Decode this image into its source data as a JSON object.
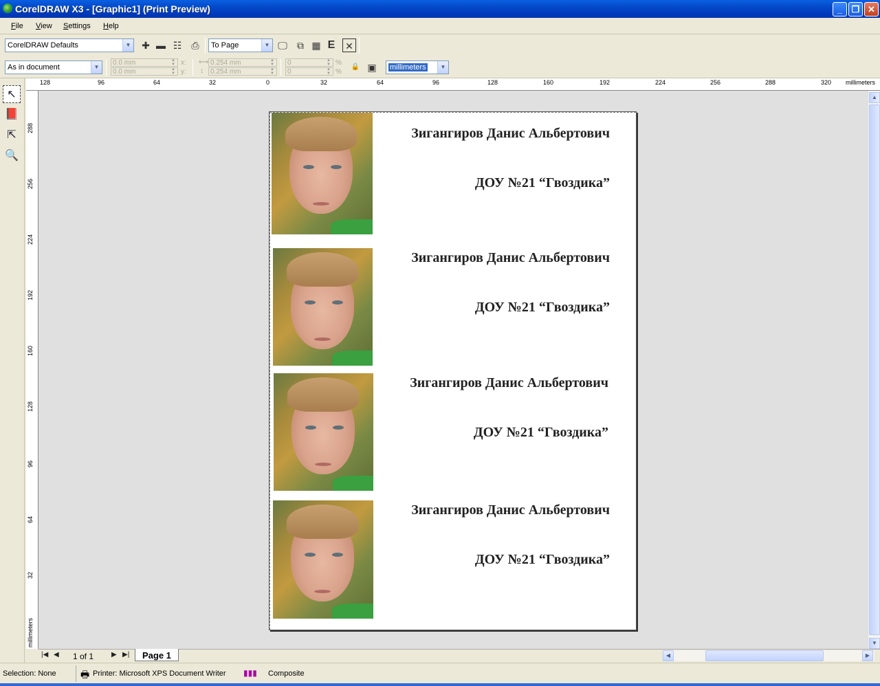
{
  "window": {
    "title": "CorelDRAW X3 - [Graphic1] (Print Preview)",
    "controls": {
      "minimize": "_",
      "maximize": "❐",
      "close": "✕"
    }
  },
  "menu": [
    "File",
    "View",
    "Settings",
    "Help"
  ],
  "toolbar1": {
    "print_style": "CorelDRAW Defaults",
    "zoom": "To Page",
    "icons": [
      "add-preset-icon",
      "remove-preset-icon",
      "print-options-icon",
      "print-icon",
      "full-screen-icon",
      "imposition-icon",
      "marks-icon",
      "emulsion-icon",
      "close-preview-icon"
    ]
  },
  "toolbar2": {
    "position": "As in document",
    "x": "0.0 mm",
    "y": "0.0 mm",
    "x_label": "x:",
    "y_label": "y:",
    "width": "0.254 mm",
    "height": "0.254 mm",
    "scale_w": "0",
    "scale_h": "0",
    "percent": "%",
    "units": "millimeters"
  },
  "ruler": {
    "units": "millimeters",
    "h_labels": [
      "128",
      "96",
      "64",
      "32",
      "0",
      "32",
      "64",
      "96",
      "128",
      "160",
      "192",
      "224",
      "256",
      "288",
      "320"
    ],
    "v_labels": [
      "288",
      "256",
      "224",
      "192",
      "160",
      "128",
      "96",
      "64",
      "32"
    ],
    "v_units": "millimeters"
  },
  "badges": [
    {
      "name": "Зигангиров Данис Альбертович",
      "org": "ДОУ №21 “Гвоздика”"
    },
    {
      "name": "Зигангиров Данис Альбертович",
      "org": "ДОУ №21 “Гвоздика”"
    },
    {
      "name": "Зигангиров Данис Альбертович",
      "org": "ДОУ №21 “Гвоздика”"
    },
    {
      "name": "Зигангиров Данис Альбертович",
      "org": "ДОУ №21 “Гвоздика”"
    }
  ],
  "pagenav": {
    "count": "1 of 1",
    "tab": "Page 1"
  },
  "status": {
    "selection": "Selection: None",
    "printer": "Printer: Microsoft XPS Document Writer",
    "mode": "Composite"
  }
}
